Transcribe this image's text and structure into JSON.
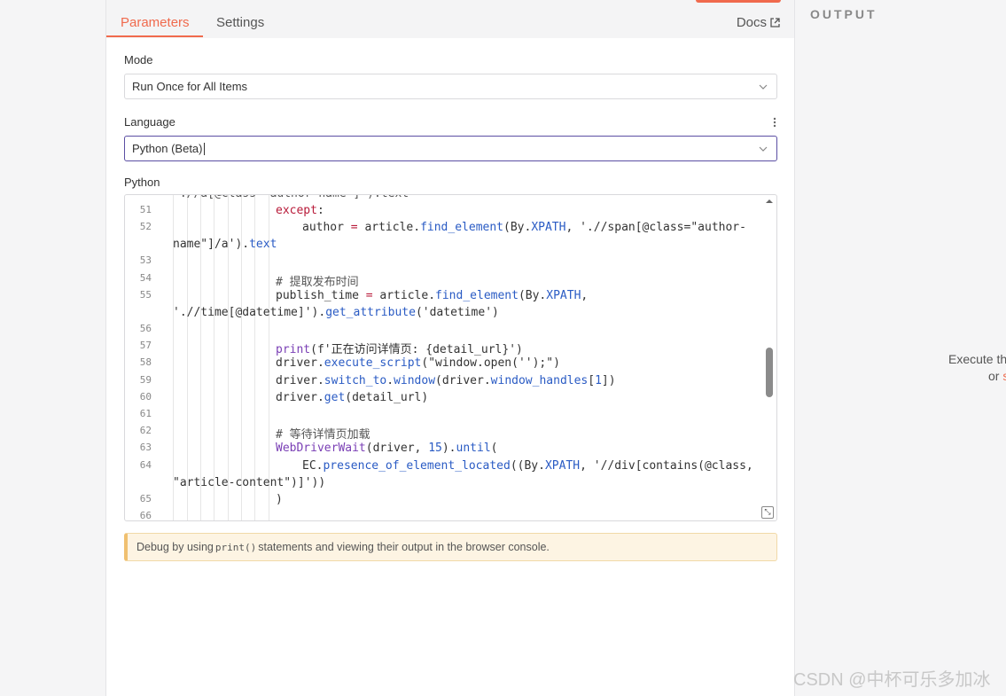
{
  "tabs": {
    "parameters": "Parameters",
    "settings": "Settings",
    "docs": "Docs"
  },
  "mode": {
    "label": "Mode",
    "value": "Run Once for All Items"
  },
  "language": {
    "label": "Language",
    "value": "Python (Beta)"
  },
  "python": {
    "label": "Python",
    "line_numbers": [
      "51",
      "52",
      "53",
      "54",
      "55",
      "56",
      "57",
      "58",
      "59",
      "60",
      "61",
      "62",
      "63",
      "64",
      "65",
      "66"
    ]
  },
  "hint": {
    "prefix": "Debug by using",
    "code": "print()",
    "suffix": "statements and viewing their output in the browser console."
  },
  "output": {
    "title": "OUTPUT",
    "execute_text": "Execute th",
    "or_text": "or",
    "or_accent": "s"
  },
  "watermark": "CSDN @中杯可乐多加冰",
  "colors": {
    "accent": "#f06a4d",
    "focus": "#5b4ea3"
  }
}
